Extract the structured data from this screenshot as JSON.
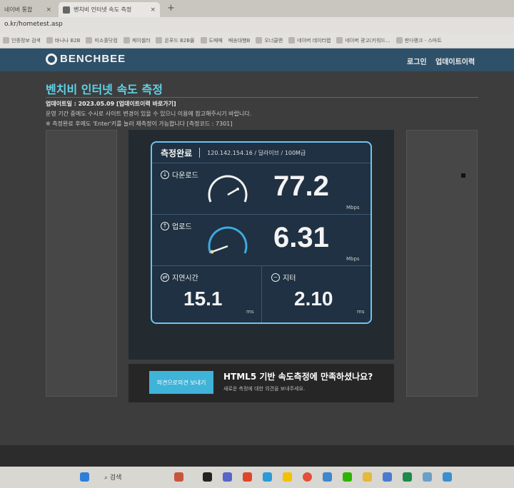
{
  "browser": {
    "tabs": [
      {
        "label": "네이버 통합"
      },
      {
        "label": "벤치비 인터넷 속도 측정"
      }
    ],
    "new_tab": "+",
    "url": "o.kr/hometest.asp",
    "bookmarks": [
      {
        "label": "인증정보 검색"
      },
      {
        "label": "바나나 B2B"
      },
      {
        "label": "미소홀닷컴"
      },
      {
        "label": "케이셀러"
      },
      {
        "label": "온푸드 B2B몰"
      },
      {
        "label": "도매매"
      },
      {
        "label": "배송대행B"
      },
      {
        "label": "오너클랜"
      },
      {
        "label": "네이버 데이터랩"
      },
      {
        "label": "네이버 광고(키워드..."
      },
      {
        "label": "판다랭크 - 스마트"
      }
    ]
  },
  "site": {
    "logo": "BENCHBEE",
    "nav": [
      "로그인",
      "업데이트이력"
    ],
    "page_title": "벤치비 인터넷 속도 측정",
    "update_line": "업데이트일 : 2023.05.09 [업데이트이력 바로가기]",
    "notice_line": "운영 기간 중에도 수시로 사이트 변경이 있을 수 있으니 이용에 참고해주시기 바랍니다.",
    "tip_line": "※ 측정완료 후에도 'Enter'키를 눌러 재측정이 가능합니다 [측정코드 : 7301]"
  },
  "result": {
    "status": "측정완료",
    "connection": "120.142.154.16 / 딜라이브 / 100M급",
    "download": {
      "label": "다운로드",
      "value": "77.2",
      "unit": "Mbps"
    },
    "upload": {
      "label": "업로드",
      "value": "6.31",
      "unit": "Mbps"
    },
    "latency": {
      "label": "지연시간",
      "value": "15.1",
      "unit": "ms"
    },
    "jitter": {
      "label": "지터",
      "value": "2.10",
      "unit": "ms"
    }
  },
  "feedback": {
    "button": "의견으로의견 보내기",
    "title": "HTML5 기반 속도측정에 만족하셨나요?",
    "subtitle": "새로운 측정에 대한 의견을 보내주세요."
  },
  "taskbar": {
    "search": "검색"
  },
  "colors": {
    "accent": "#5fd3ea",
    "header": "#2f5069",
    "card_border": "#6fc3f0"
  }
}
